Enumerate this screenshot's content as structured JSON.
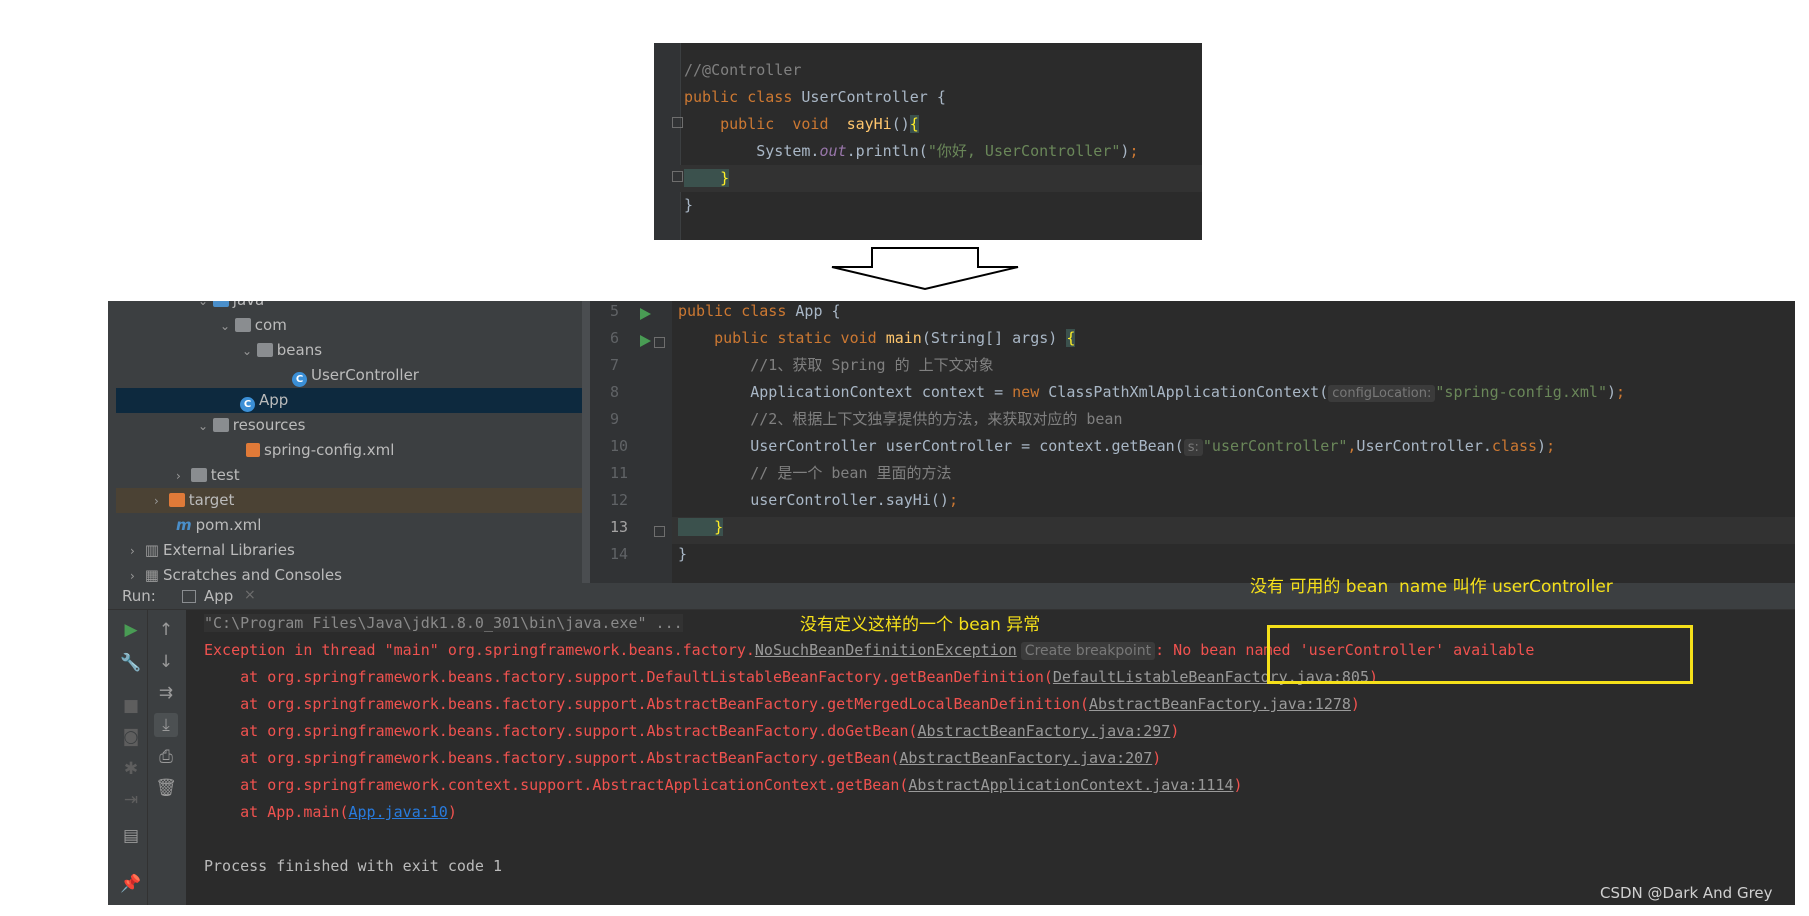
{
  "snippet": {
    "lines": [
      "//@Controller",
      "public class UserController {",
      "    public  void  sayHi(){",
      "        System.out.println(\"你好, UserController\");",
      "    }",
      "}"
    ]
  },
  "project_tree": {
    "items": [
      {
        "label": "java"
      },
      {
        "label": "com"
      },
      {
        "label": "beans"
      },
      {
        "label": "UserController"
      },
      {
        "label": "App"
      },
      {
        "label": "resources"
      },
      {
        "label": "spring-config.xml"
      },
      {
        "label": "test"
      },
      {
        "label": "target"
      },
      {
        "label": "pom.xml"
      },
      {
        "label": "External Libraries"
      },
      {
        "label": "Scratches and Consoles"
      }
    ]
  },
  "editor": {
    "line_numbers": [
      "5",
      "6",
      "7",
      "8",
      "9",
      "10",
      "11",
      "12",
      "13",
      "14"
    ],
    "hint_config": "configLocation:",
    "hint_s": "s:",
    "comment1": "//1、获取 Spring 的 上下文对象",
    "comment2": "//2、根据上下文独享提供的方法，来获取对应的 bean",
    "comment3": "// 是一个 bean 里面的方法",
    "config_str": "\"spring-config.xml\"",
    "bean_str": "\"userController\""
  },
  "run_panel": {
    "label": "Run:",
    "tab": "App",
    "close": "×"
  },
  "console": {
    "cmd": "\"C:\\Program Files\\Java\\jdk1.8.0_301\\bin\\java.exe\" ...",
    "exception_prefix": "Exception in thread \"main\" org.springframework.beans.factory.",
    "exception_class": "NoSuchBeanDefinitionException",
    "create_breakpoint": "Create breakpoint",
    "exception_msg": ": No bean named 'userController' available",
    "stack": [
      {
        "text": "    at org.springframework.beans.factory.support.DefaultListableBeanFactory.getBeanDefinition(",
        "link": "DefaultListableBeanFactory.java:805"
      },
      {
        "text": "    at org.springframework.beans.factory.support.AbstractBeanFactory.getMergedLocalBeanDefinition(",
        "link": "AbstractBeanFactory.java:1278"
      },
      {
        "text": "    at org.springframework.beans.factory.support.AbstractBeanFactory.doGetBean(",
        "link": "AbstractBeanFactory.java:297"
      },
      {
        "text": "    at org.springframework.beans.factory.support.AbstractBeanFactory.getBean(",
        "link": "AbstractBeanFactory.java:207"
      },
      {
        "text": "    at org.springframework.context.support.AbstractApplicationContext.getBean(",
        "link": "AbstractApplicationContext.java:1114"
      },
      {
        "text": "    at App.main(",
        "link": "App.java:10"
      }
    ],
    "finish": "Process finished with exit code 1"
  },
  "annotations": {
    "top": "没有 可用的 bean  name 叫作 userController",
    "mid": "没有定义这样的一个 bean 异常"
  },
  "watermark": "CSDN @Dark And Grey",
  "colors": {
    "keyword": "#cc7832",
    "method": "#ffc66d",
    "string": "#6a8759",
    "comment": "#808080",
    "field": "#9876aa",
    "error": "#f0524f",
    "annotation": "#f5e01a"
  }
}
